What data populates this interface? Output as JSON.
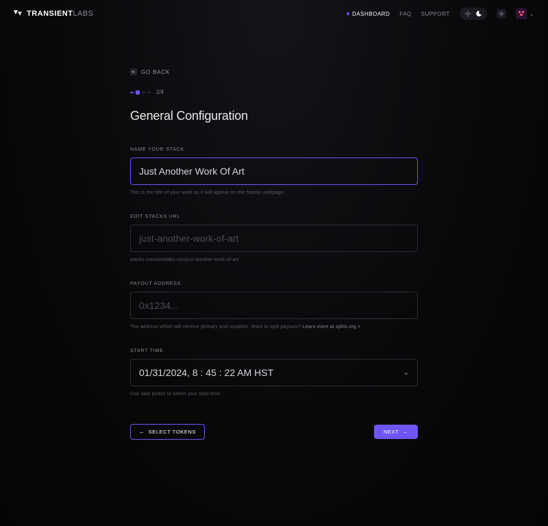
{
  "brand": {
    "strong": "TRANSIENT",
    "light": "LABS"
  },
  "nav": {
    "dashboard": "DASHBOARD",
    "faq": "FAQ",
    "support": "SUPPORT"
  },
  "page": {
    "go_back": "GO BACK",
    "step_label": "2/4",
    "title": "General Configuration"
  },
  "fields": {
    "name": {
      "label": "NAME YOUR STACK",
      "value": "Just Another Work Of Art",
      "helper": "This is the title of your work as it will appear on the Stacks webpage."
    },
    "url": {
      "label": "EDIT STACKS URL",
      "placeholder": "just-another-work-of-art",
      "helper": "stacks.transientlabs.xyz/just-another-work-of-art"
    },
    "payout": {
      "label": "PAYOUT ADDRESS",
      "placeholder": "0x1234...",
      "helper_text": "The address which will receive primary and royalties. Want to split payouts? ",
      "helper_link": "Learn more at splits.org >"
    },
    "start": {
      "label": "START TIME",
      "value": "01/31/2024, 8 : 45 : 22 AM HST",
      "helper": "Use date picker to select your start time."
    }
  },
  "buttons": {
    "select_tokens": "SELECT TOKENS",
    "next": "NEXT"
  }
}
